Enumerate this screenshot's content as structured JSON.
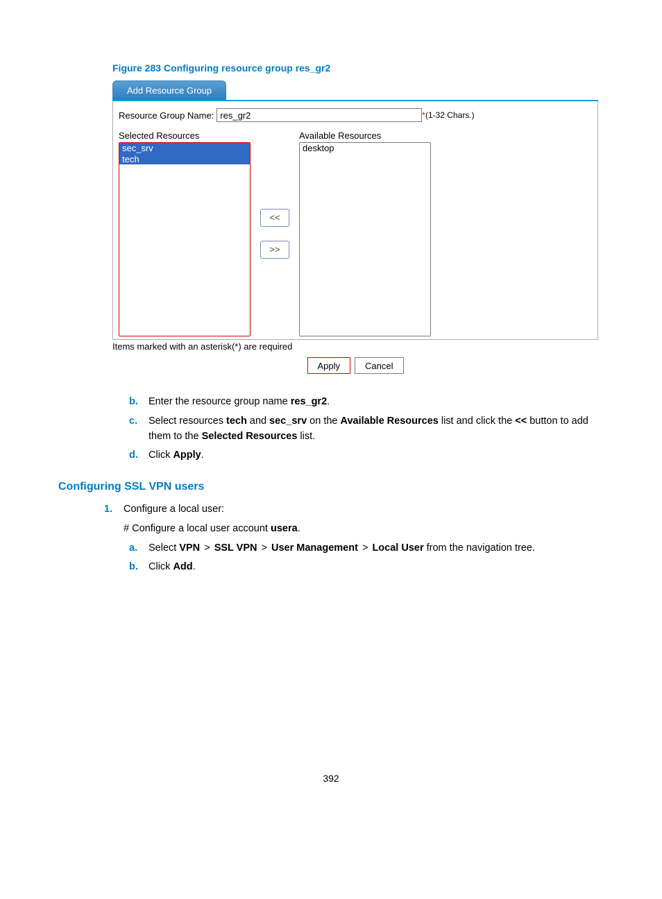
{
  "figure_caption": "Figure 283 Configuring resource group res_gr2",
  "tab_title": "Add Resource Group",
  "form": {
    "name_label": "Resource Group Name:",
    "name_value": "res_gr2",
    "chars_hint_star": "*",
    "chars_hint": "(1-32 Chars.)",
    "selected_label": "Selected Resources",
    "available_label": "Available Resources",
    "selected_items": [
      "sec_srv",
      "tech"
    ],
    "available_items": [
      "desktop"
    ],
    "move_left": "<<",
    "move_right": ">>"
  },
  "required_note": "Items marked with an asterisk(*) are required",
  "buttons": {
    "apply": "Apply",
    "cancel": "Cancel"
  },
  "steps_letters": {
    "b": {
      "marker": "b.",
      "prefix": "Enter the resource group name ",
      "bold1": "res_gr2",
      "suffix": "."
    },
    "c": {
      "marker": "c.",
      "t1": "Select resources ",
      "b1": "tech",
      "t2": " and ",
      "b2": "sec_srv",
      "t3": " on the ",
      "b3": "Available Resources",
      "t4": " list and click the ",
      "b4": "<<",
      "t5": " button to add them to the ",
      "b5": "Selected Resources",
      "t6": " list."
    },
    "d": {
      "marker": "d.",
      "t1": "Click ",
      "b1": "Apply",
      "t2": "."
    }
  },
  "heading_ssl": "Configuring SSL VPN users",
  "num_steps": {
    "one": {
      "marker": "1.",
      "text": "Configure a local user:"
    }
  },
  "comment_line": {
    "t1": "# Configure a local user account ",
    "b1": "usera",
    "t2": "."
  },
  "sub_letters": {
    "a": {
      "marker": "a.",
      "t1": "Select ",
      "b1": "VPN",
      "gt1": " > ",
      "b2": "SSL VPN",
      "gt2": " > ",
      "b3": "User Management",
      "gt3": " > ",
      "b4": "Local User",
      "t2": " from the navigation tree."
    },
    "b": {
      "marker": "b.",
      "t1": "Click ",
      "b1": "Add",
      "t2": "."
    }
  },
  "page_number": "392"
}
